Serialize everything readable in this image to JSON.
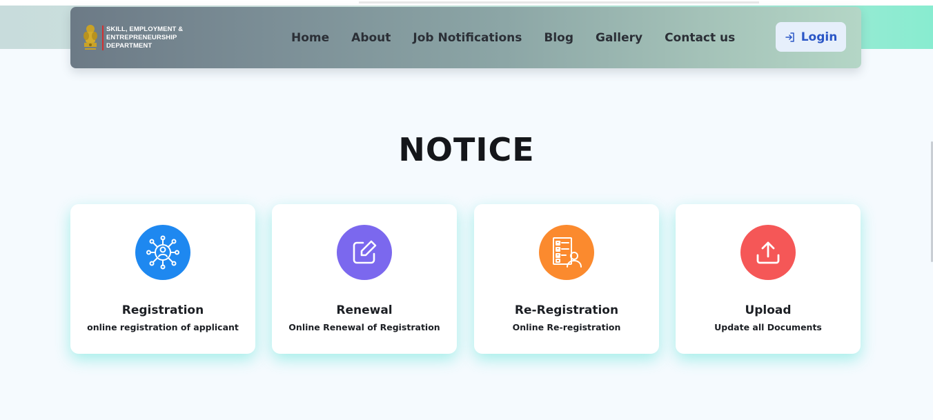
{
  "header": {
    "logo_text_line1": "SKILL, EMPLOYMENT &",
    "logo_text_line2": "ENTREPRENEURSHIP",
    "logo_text_line3": "DEPARTMENT",
    "nav": [
      "Home",
      "About",
      "Job Notifications",
      "Blog",
      "Gallery",
      "Contact us"
    ],
    "login_label": "Login"
  },
  "main": {
    "title": "NOTICE",
    "cards": [
      {
        "title": "Registration",
        "subtitle": "online registration of applicant",
        "icon": "network-user-icon",
        "color": "#1e88f0"
      },
      {
        "title": "Renewal",
        "subtitle": "Online Renewal of Registration",
        "icon": "edit-icon",
        "color": "#7b68ee"
      },
      {
        "title": "Re-Registration",
        "subtitle": "Online Re-registration",
        "icon": "checklist-user-icon",
        "color": "#fb8a2e"
      },
      {
        "title": "Upload",
        "subtitle": "Update all Documents",
        "icon": "upload-icon",
        "color": "#f55757"
      }
    ]
  },
  "colors": {
    "accent_blue": "#2a56c6",
    "card_glow": "#40e0d0"
  }
}
